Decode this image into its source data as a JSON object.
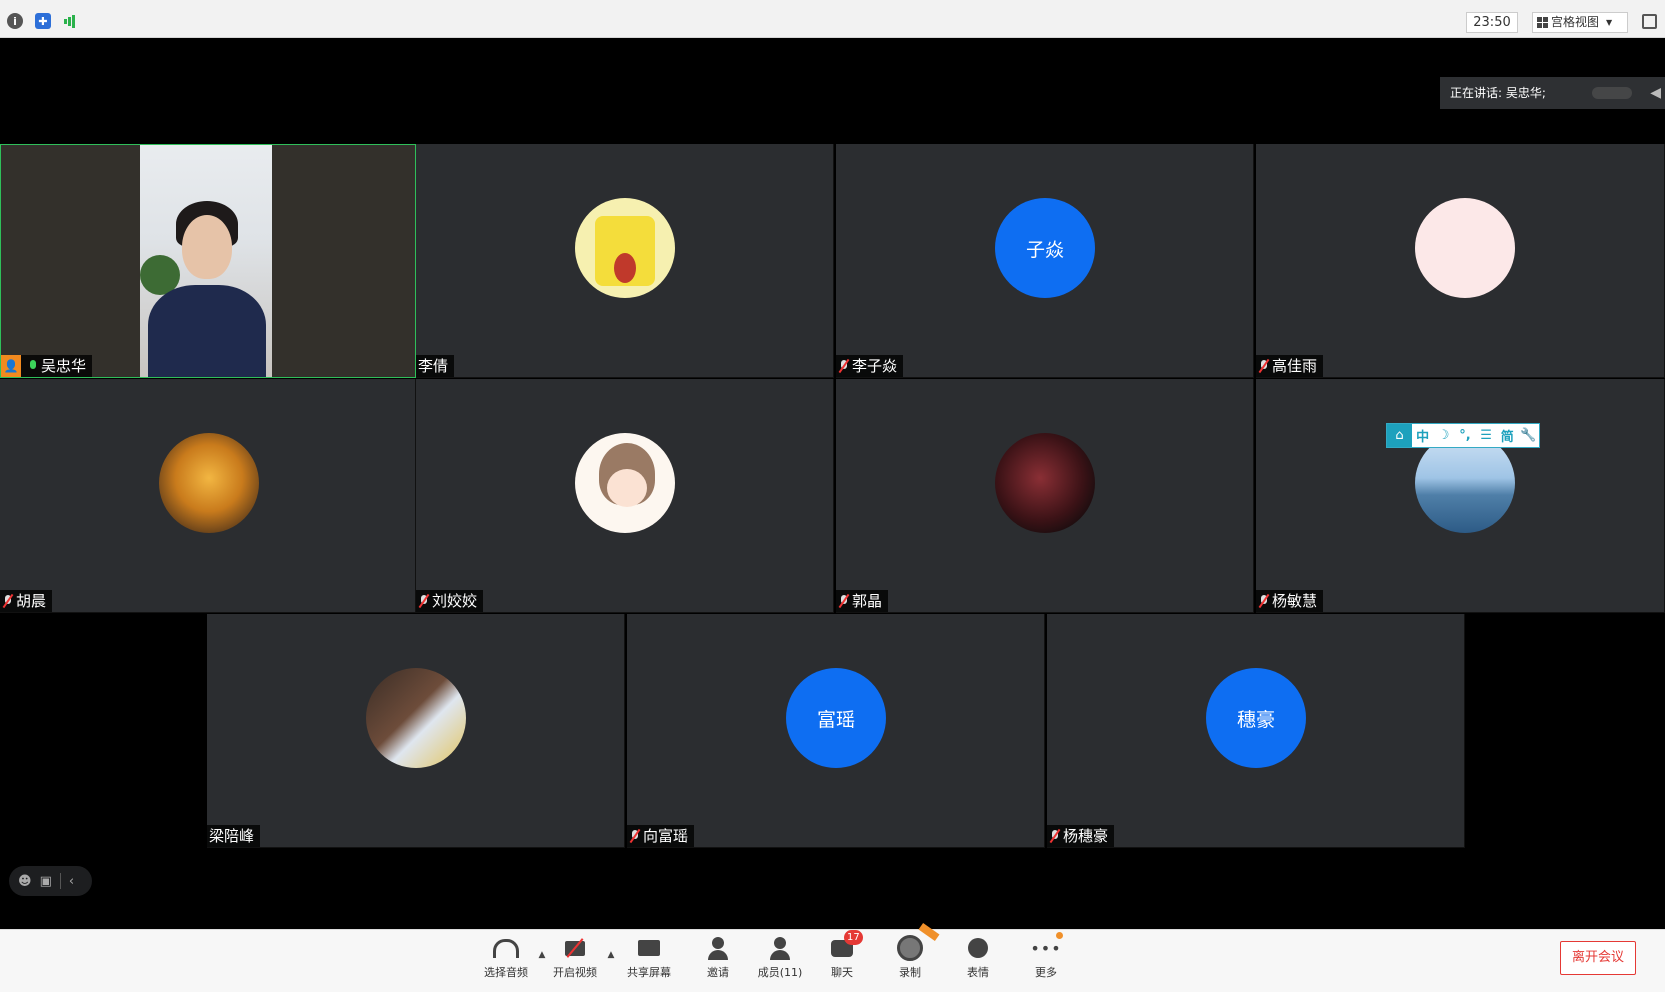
{
  "topbar": {
    "icons": [
      "info-icon",
      "shield-icon",
      "signal-icon"
    ],
    "clock": "23:50",
    "view_label": "宫格视图"
  },
  "speaking": {
    "text": "正在讲话: 吴忠华;"
  },
  "participants": [
    {
      "name": "吴忠华",
      "mic": "on",
      "host": true,
      "avatar": "video"
    },
    {
      "name": "李倩",
      "mic": "none",
      "avatar": "spongebob-image"
    },
    {
      "name": "李子焱",
      "mic": "off",
      "avatar_text": "子焱"
    },
    {
      "name": "高佳雨",
      "mic": "off",
      "avatar": "calligraphy-image"
    },
    {
      "name": "胡晨",
      "mic": "off",
      "avatar": "autumn-tree-image"
    },
    {
      "name": "刘姣姣",
      "mic": "off",
      "avatar": "cartoon-girl-image"
    },
    {
      "name": "郭晶",
      "mic": "off",
      "avatar": "dark-photo-image"
    },
    {
      "name": "杨敏慧",
      "mic": "off",
      "avatar": "lake-photo-image"
    },
    {
      "name": "梁陪峰",
      "mic": "none",
      "avatar": "house-photo-image"
    },
    {
      "name": "向富瑶",
      "mic": "off",
      "avatar_text": "富瑶"
    },
    {
      "name": "杨穗豪",
      "mic": "off",
      "avatar_text": "穗豪"
    }
  ],
  "ime": {
    "items": [
      "中",
      "☽",
      "°,",
      "☰",
      "简",
      "🔧"
    ]
  },
  "toolbar": {
    "audio": "选择音频",
    "video": "开启视频",
    "share": "共享屏幕",
    "invite": "邀请",
    "members": "成员(11)",
    "chat": "聊天",
    "chat_badge": "17",
    "record": "录制",
    "emoji": "表情",
    "more": "更多",
    "leave": "离开会议"
  },
  "colors": {
    "accent_blue": "#0e6ef2",
    "active_border": "#2fbf5a",
    "leave_red": "#e53935"
  }
}
